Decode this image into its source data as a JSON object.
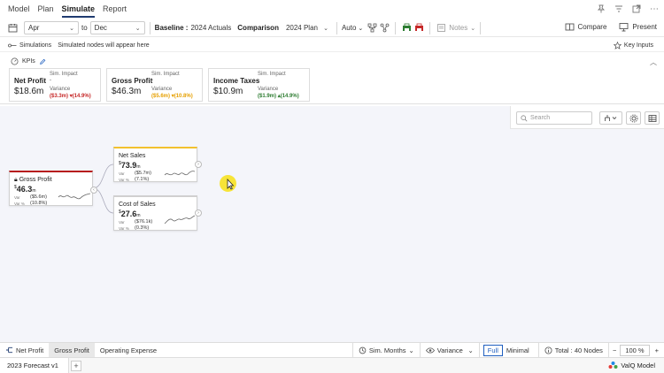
{
  "menu": [
    "Model",
    "Plan",
    "Simulate",
    "Report"
  ],
  "menu_active_index": 2,
  "toolbar": {
    "from_period": "Apr",
    "to_label": "to",
    "to_period": "Dec",
    "baseline_label": "Baseline :",
    "baseline_value": "2024 Actuals",
    "comparison_label": "Comparison",
    "comparison_value": "2024 Plan",
    "auto_label": "Auto",
    "notes_label": "Notes",
    "compare_label": "Compare",
    "present_label": "Present"
  },
  "simbar": {
    "simulations_label": "Simulations",
    "hint": "Simulated nodes will appear here",
    "key_inputs_label": "Key Inputs"
  },
  "kpis": {
    "header": "KPIs",
    "cards": [
      {
        "name": "Net Profit",
        "value": "$18.6m",
        "sim_label": "Sim. Impact",
        "sim_value": "-",
        "var_label": "Variance",
        "var_abs": "($3.3m)",
        "var_pct": "(14.9%)",
        "var_color": "#c62828"
      },
      {
        "name": "Gross Profit",
        "value": "$46.3m",
        "sim_label": "Sim. Impact",
        "sim_value": "-",
        "var_label": "Variance",
        "var_abs": "($5.6m)",
        "var_pct": "(10.8%)",
        "var_color": "#e6a000"
      },
      {
        "name": "Income Taxes",
        "value": "$10.9m",
        "sim_label": "Sim. Impact",
        "sim_value": "-",
        "var_label": "Variance",
        "var_abs": "($1.9m)",
        "var_pct": "(14.9%)",
        "var_color": "#2e7d32"
      }
    ]
  },
  "canvas": {
    "search_placeholder": "Search",
    "nodes": {
      "root": {
        "title": "Gross Profit",
        "value": "46.3",
        "unit": "m",
        "var_label": "Var",
        "var_value": "($5.6m)",
        "varpct_label": "Var %",
        "varpct_value": "(10.8%)",
        "accent": "#b71c1c"
      },
      "net_sales": {
        "title": "Net Sales",
        "value": "73.9",
        "unit": "m",
        "var_label": "Var",
        "var_value": "($5.7m)",
        "varpct_label": "Var %",
        "varpct_value": "(7.1%)",
        "accent": "#f2c12e"
      },
      "cost_of_sales": {
        "title": "Cost of Sales",
        "value": "27.6",
        "unit": "m",
        "var_label": "Var",
        "var_value": "($76.1k)",
        "varpct_label": "Var %",
        "varpct_value": "(0.3%)",
        "accent": "#d0d0d0"
      }
    }
  },
  "bottom": {
    "view_tabs": [
      "Net Profit",
      "Gross Profit",
      "Operating Expense"
    ],
    "active_view_index": 1,
    "sim_months_label": "Sim. Months",
    "variance_label": "Variance",
    "full_label": "Full",
    "minimal_label": "Minimal",
    "total_nodes": "Total : 40 Nodes",
    "zoom": "100 %",
    "minus": "−",
    "plus": "+"
  },
  "status": {
    "forecast_tab": "2023 Forecast v1",
    "add_tab": "+",
    "brand": "ValQ Model"
  }
}
